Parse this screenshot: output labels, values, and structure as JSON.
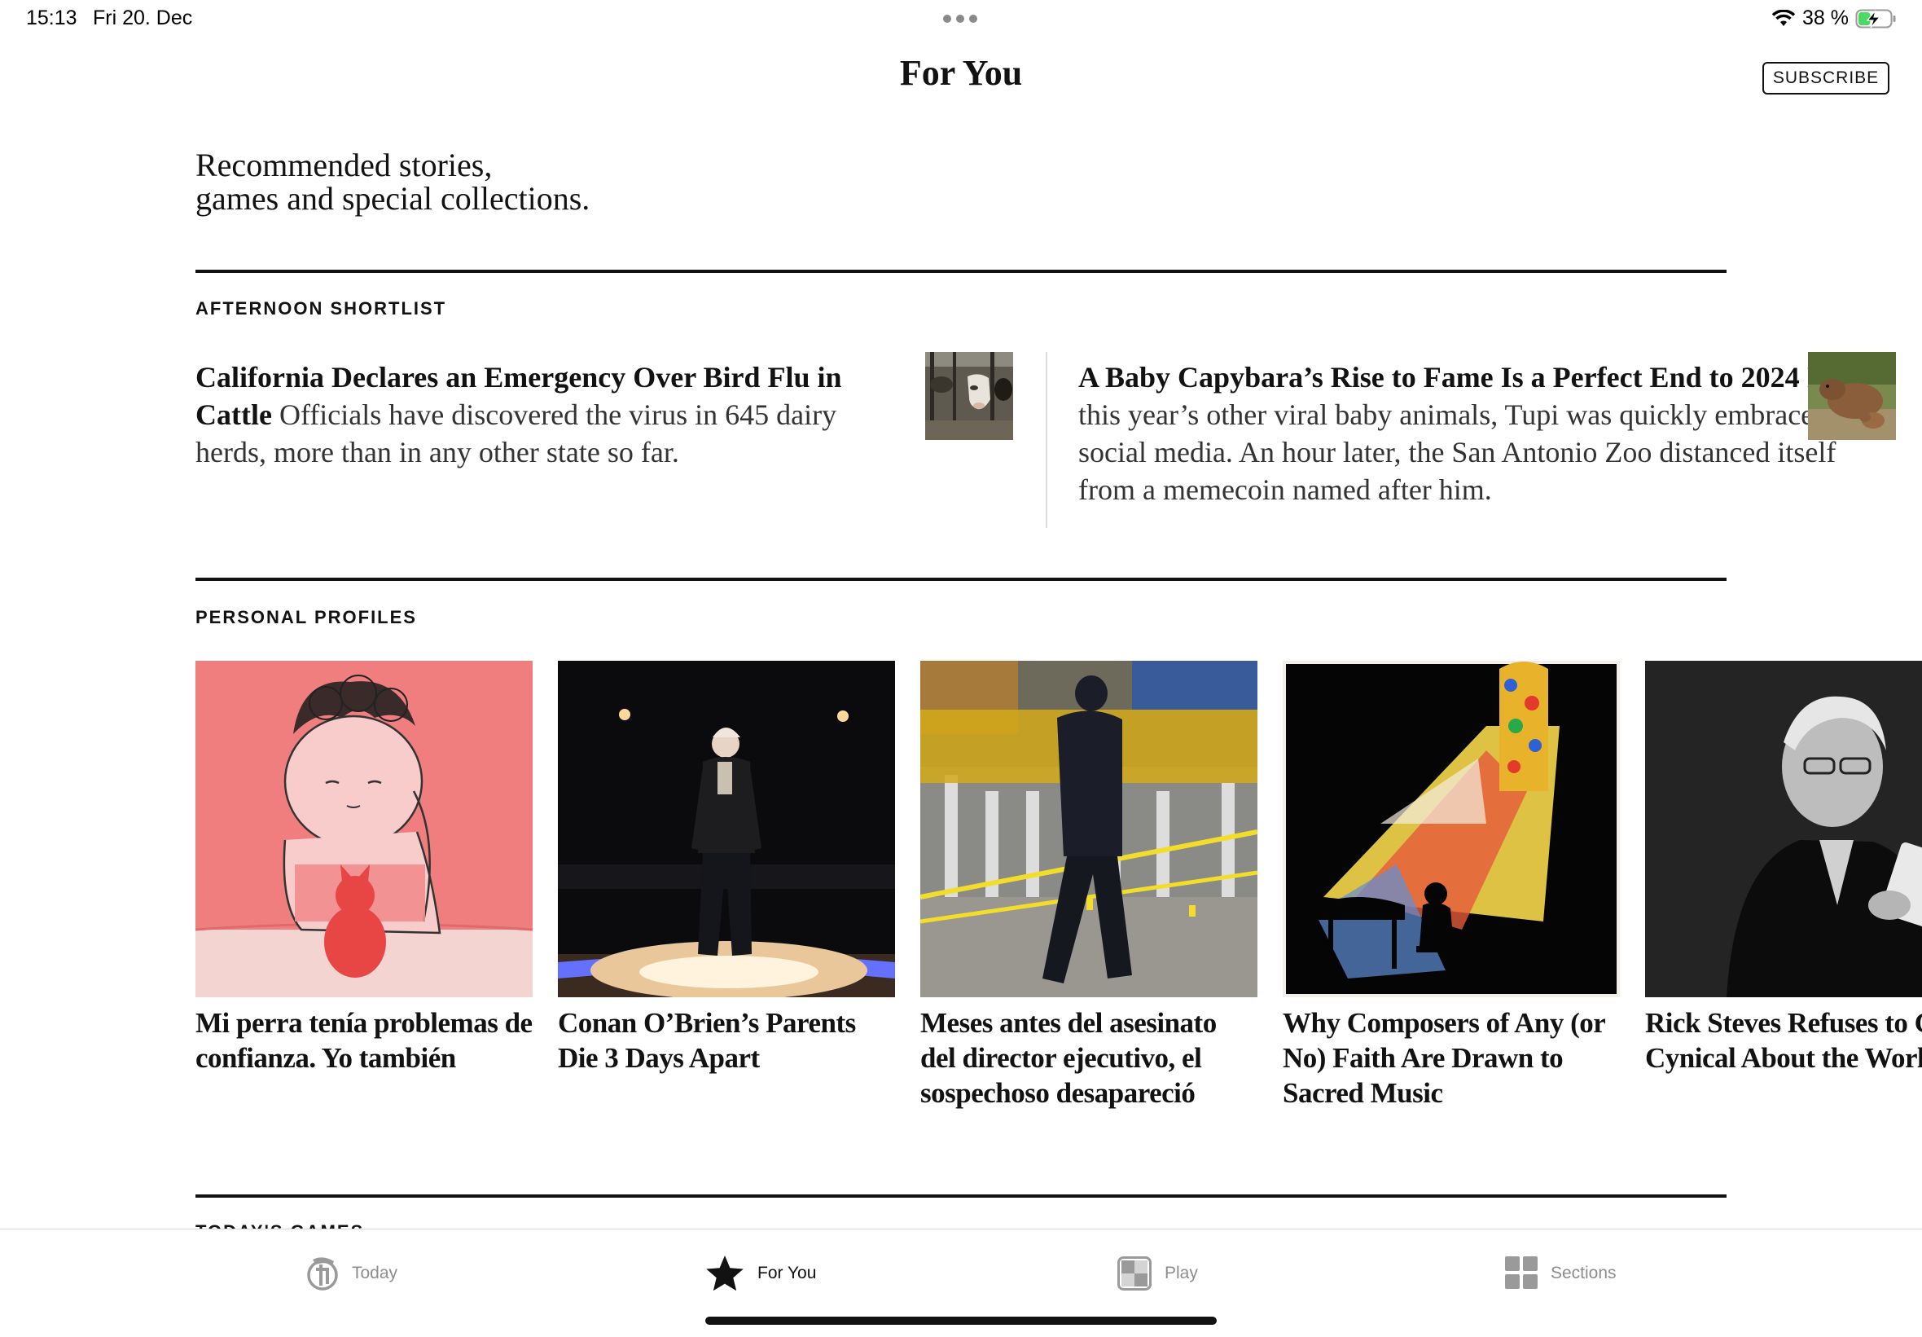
{
  "status_bar": {
    "time": "15:13",
    "date": "Fri 20. Dec",
    "battery": "38 %",
    "battery_level": 0.38,
    "icons": [
      "wifi-icon",
      "battery-charging-icon"
    ]
  },
  "header": {
    "title": "For You",
    "subscribe_label": "SUBSCRIBE"
  },
  "intro": {
    "line1": "Recommended stories,",
    "line2": "games and special collections."
  },
  "afternoon_shortlist": {
    "label": "AFTERNOON SHORTLIST",
    "stories": [
      {
        "headline": "California Declares an Emergency Over Bird Flu in Cattle",
        "summary": "Officials have discovered the virus in 645 dairy herds, more than in any other state so far.",
        "thumbnail": "dairy cows"
      },
      {
        "headline": "A Baby Capybara’s Rise to Fame Is a Perfect End to 2024",
        "summary": "Like this year’s other viral baby animals, Tupi was quickly embraced on social media. An hour later, the San Antonio Zoo distanced itself from a memecoin named after him.",
        "thumbnail": "capybara"
      }
    ]
  },
  "personal_profiles": {
    "label": "PERSONAL PROFILES",
    "cards": [
      {
        "title": "Mi perra tenía problemas de confianza. Yo también",
        "image": "illustration of woman and dog"
      },
      {
        "title": "Conan O’Brien’s Parents Die 3 Days Apart",
        "image": "man standing on stage"
      },
      {
        "title": "Meses antes del asesinato del director ejecutivo, el sospechoso desapareció",
        "image": "police officer at crime scene"
      },
      {
        "title": "Why Composers of Any (or No) Faith Are Drawn to Sacred Music",
        "image": "pianist and stained glass window"
      },
      {
        "title": "Rick Steves Refuses to Get Cynical About the World",
        "image": "portrait of man writing in notebook"
      }
    ]
  },
  "next_section_label": "TODAY'S GAMES",
  "tab_bar": {
    "tabs": [
      {
        "label": "Today",
        "icon": "nyt-logo-icon",
        "active": false
      },
      {
        "label": "For You",
        "icon": "star-icon",
        "active": true
      },
      {
        "label": "Play",
        "icon": "play-grid-icon",
        "active": false
      },
      {
        "label": "Sections",
        "icon": "sections-grid-icon",
        "active": false
      }
    ]
  }
}
